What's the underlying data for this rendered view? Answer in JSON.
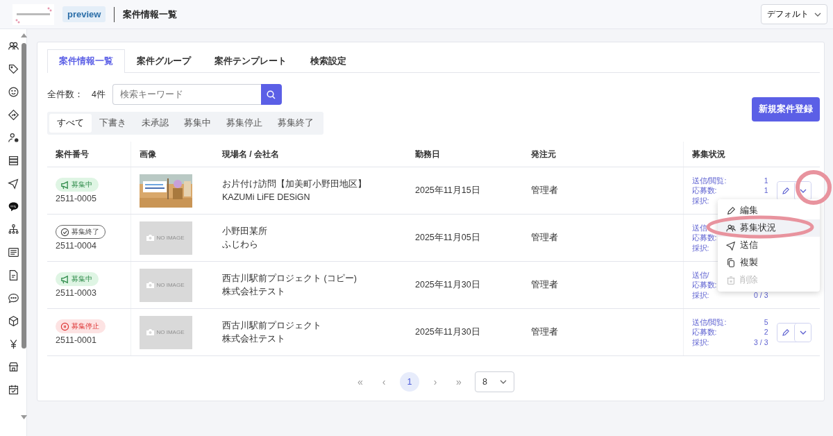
{
  "header": {
    "env_badge": "preview",
    "title": "案件情報一覧",
    "view_select": "デフォルト"
  },
  "tabs": [
    {
      "label": "案件情報一覧",
      "selected": true
    },
    {
      "label": "案件グループ",
      "selected": false
    },
    {
      "label": "案件テンプレート",
      "selected": false
    },
    {
      "label": "検索設定",
      "selected": false
    }
  ],
  "toolbar": {
    "count_label": "全件数：",
    "count": "4件",
    "search_placeholder": "検索キーワード",
    "new_button": "新規案件登録"
  },
  "filters": [
    {
      "label": "すべて",
      "selected": true
    },
    {
      "label": "下書き",
      "selected": false
    },
    {
      "label": "未承認",
      "selected": false
    },
    {
      "label": "募集中",
      "selected": false
    },
    {
      "label": "募集停止",
      "selected": false
    },
    {
      "label": "募集終了",
      "selected": false
    }
  ],
  "table": {
    "columns": [
      "案件番号",
      "画像",
      "現場名 / 会社名",
      "勤務日",
      "発注元",
      "募集状況"
    ],
    "rows": [
      {
        "number": "2511-0005",
        "status": {
          "kind": "recruiting",
          "label": "募集中"
        },
        "image": {
          "kind": "picture"
        },
        "site": "お片付け訪問【加美町小野田地区】",
        "company": "KAZUMi LiFE DESiGN",
        "date": "2025年11月15日",
        "client": "管理者",
        "stats": [
          {
            "label": "送信/閲覧:",
            "value": "1"
          },
          {
            "label": "応募数:",
            "value": "1"
          },
          {
            "label": "採択:"
          }
        ],
        "actions": true
      },
      {
        "number": "2511-0004",
        "status": {
          "kind": "closed",
          "label": "募集終了"
        },
        "image": {
          "kind": "none",
          "text": "NO IMAGE"
        },
        "site": "小野田某所",
        "company": "ふじわら",
        "date": "2025年11月05日",
        "client": "管理者",
        "stats": [
          {
            "label": "送信"
          },
          {
            "label": "応募数:"
          },
          {
            "label": "採択:"
          }
        ],
        "actions": false
      },
      {
        "number": "2511-0003",
        "status": {
          "kind": "recruiting",
          "label": "募集中"
        },
        "image": {
          "kind": "none",
          "text": "NO IMAGE"
        },
        "site": "西古川駅前プロジェクト (コピー)",
        "company": "株式会社テスト",
        "date": "2025年11月30日",
        "client": "管理者",
        "stats": [
          {
            "label": "送信/"
          },
          {
            "label": "応募数:"
          },
          {
            "label": "採択:",
            "value": "0 / 3"
          }
        ],
        "actions": false
      },
      {
        "number": "2511-0001",
        "status": {
          "kind": "paused",
          "label": "募集停止"
        },
        "image": {
          "kind": "none",
          "text": "NO IMAGE"
        },
        "site": "西古川駅前プロジェクト",
        "company": "株式会社テスト",
        "date": "2025年11月30日",
        "client": "管理者",
        "stats": [
          {
            "label": "送信/閲覧:",
            "value": "5"
          },
          {
            "label": "応募数:",
            "value": "2"
          },
          {
            "label": "採択:",
            "value": "3 / 3"
          }
        ],
        "actions": true
      }
    ]
  },
  "row_menu": {
    "items": [
      {
        "kind": "edit",
        "label": "編集",
        "selected": false,
        "disabled": false
      },
      {
        "kind": "status",
        "label": "募集状況",
        "selected": true,
        "disabled": false
      },
      {
        "kind": "send",
        "label": "送信",
        "selected": false,
        "disabled": false
      },
      {
        "kind": "copy",
        "label": "複製",
        "selected": false,
        "disabled": false
      },
      {
        "kind": "delete",
        "label": "削除",
        "selected": false,
        "disabled": true
      }
    ]
  },
  "pagination": {
    "first": "«",
    "prev": "‹",
    "pages": [
      {
        "label": "1",
        "selected": true
      }
    ],
    "next": "›",
    "last": "»",
    "page_size": "8"
  }
}
